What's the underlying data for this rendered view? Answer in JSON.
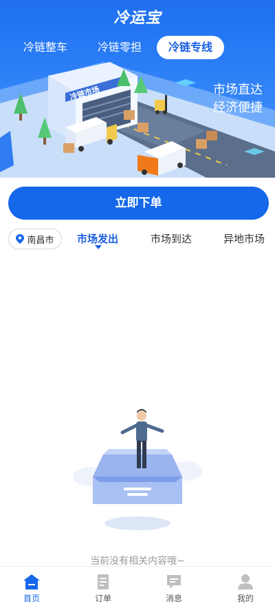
{
  "app": {
    "title": "冷运宝"
  },
  "top_tabs": [
    {
      "label": "冷链整车"
    },
    {
      "label": "冷链零担"
    },
    {
      "label": "冷链专线"
    }
  ],
  "banner": {
    "line1": "市场直达",
    "line2": "经济便捷",
    "building_sign": "冷链市场"
  },
  "order_button": {
    "label": "立即下单"
  },
  "location": {
    "city": "南昌市"
  },
  "sub_tabs": [
    {
      "label": "市场发出"
    },
    {
      "label": "市场到达"
    },
    {
      "label": "异地市场"
    }
  ],
  "empty_state": {
    "message": "当前没有相关内容哦~"
  },
  "bottom_nav": [
    {
      "label": "首页",
      "icon": "home-icon"
    },
    {
      "label": "订单",
      "icon": "order-icon"
    },
    {
      "label": "消息",
      "icon": "message-icon"
    },
    {
      "label": "我的",
      "icon": "profile-icon"
    }
  ],
  "colors": {
    "primary": "#1668ea",
    "header_top": "#1f6ff0",
    "active_tab_text": "#1a5fe0",
    "muted_text": "#999999"
  }
}
